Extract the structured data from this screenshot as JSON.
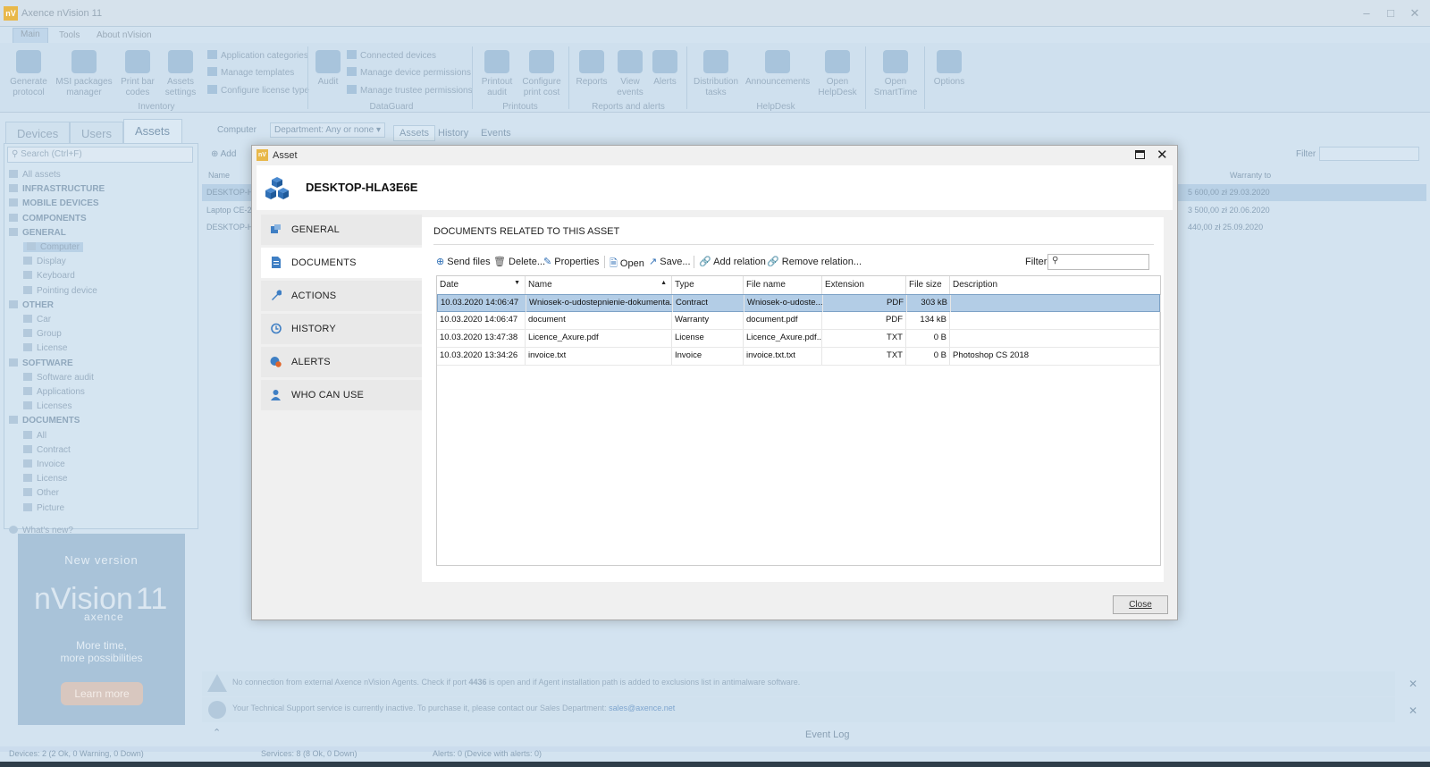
{
  "app": {
    "title": "Axence nVision 11"
  },
  "menu": {
    "tabs": [
      "Main",
      "Tools",
      "About nVision"
    ]
  },
  "ribbon": {
    "inventory": {
      "generate_protocol": "Generate protocol",
      "msi_packages": "MSI packages manager",
      "print_bar_codes": "Print bar codes",
      "assets_settings": "Assets settings",
      "application_categories": "Application categories",
      "manage_templates": "Manage templates",
      "configure_license_type": "Configure license type",
      "group": "Inventory"
    },
    "dataguard": {
      "audit": "Audit",
      "connected_devices": "Connected devices",
      "manage_device_permissions": "Manage device permissions",
      "manage_trustee_permissions": "Manage trustee permissions",
      "group": "DataGuard"
    },
    "printouts": {
      "printout_audit": "Printout audit",
      "configure_print_cost": "Configure print cost",
      "group": "Printouts"
    },
    "reports": {
      "reports": "Reports",
      "view_events": "View events",
      "alerts": "Alerts",
      "group": "Reports and alerts"
    },
    "helpdesk": {
      "distribution_tasks": "Distribution tasks",
      "announcements": "Announcements",
      "open_helpdesk": "Open HelpDesk",
      "group": "HelpDesk"
    },
    "smarttime": {
      "open_smarttime": "Open SmartTime"
    },
    "options": {
      "options": "Options"
    }
  },
  "left": {
    "tabs": [
      "Devices",
      "Users",
      "Assets"
    ],
    "search_placeholder": "Search (Ctrl+F)",
    "tree": [
      {
        "label": "All assets",
        "bold": false,
        "indent": 0
      },
      {
        "label": "INFRASTRUCTURE",
        "bold": true,
        "indent": 0
      },
      {
        "label": "MOBILE DEVICES",
        "bold": true,
        "indent": 0
      },
      {
        "label": "COMPONENTS",
        "bold": true,
        "indent": 0
      },
      {
        "label": "GENERAL",
        "bold": true,
        "indent": 0
      },
      {
        "label": "Computer",
        "bold": false,
        "indent": 1
      },
      {
        "label": "Display",
        "bold": false,
        "indent": 1
      },
      {
        "label": "Keyboard",
        "bold": false,
        "indent": 1
      },
      {
        "label": "Pointing device",
        "bold": false,
        "indent": 1
      },
      {
        "label": "OTHER",
        "bold": true,
        "indent": 0
      },
      {
        "label": "Car",
        "bold": false,
        "indent": 1
      },
      {
        "label": "Group",
        "bold": false,
        "indent": 1
      },
      {
        "label": "License",
        "bold": false,
        "indent": 1
      },
      {
        "label": "SOFTWARE",
        "bold": true,
        "indent": 0
      },
      {
        "label": "Software audit",
        "bold": false,
        "indent": 1
      },
      {
        "label": "Applications",
        "bold": false,
        "indent": 1
      },
      {
        "label": "Licenses",
        "bold": false,
        "indent": 1
      },
      {
        "label": "DOCUMENTS",
        "bold": true,
        "indent": 0
      },
      {
        "label": "All",
        "bold": false,
        "indent": 1
      },
      {
        "label": "Contract",
        "bold": false,
        "indent": 1
      },
      {
        "label": "Invoice",
        "bold": false,
        "indent": 1
      },
      {
        "label": "License",
        "bold": false,
        "indent": 1
      },
      {
        "label": "Other",
        "bold": false,
        "indent": 1
      },
      {
        "label": "Picture",
        "bold": false,
        "indent": 1
      }
    ],
    "whats_new": "What's new?",
    "promo": {
      "heading": "New version",
      "brand": "nVision",
      "version": "11",
      "maker": "axence",
      "tagline1": "More time,",
      "tagline2": "more possibilities",
      "button": "Learn more"
    }
  },
  "main": {
    "toolbar": {
      "computer": "Computer",
      "department": "Department: Any or none",
      "tabs": [
        "Assets",
        "History",
        "Events"
      ],
      "add": "Add",
      "filter": "Filter"
    },
    "columns": {
      "name": "Name",
      "warranty": "Warranty to"
    },
    "rows": [
      {
        "name": "DESKTOP-H",
        "warranty": "5 600,00 zł  29.03.2020"
      },
      {
        "name": "Laptop CE-2",
        "warranty": "3 500,00 zł  20.06.2020"
      },
      {
        "name": "DESKTOP-H",
        "warranty": "440,00 zł  25.09.2020"
      }
    ],
    "notices": [
      {
        "prefix": "No connection from external Axence nVision Agents. Check if port ",
        "port": "4436",
        "suffix": " is open and if Agent installation path is added to exclusions list in antimalware software."
      },
      {
        "text": "Your Technical Support service is currently inactive. To purchase it, please contact our Sales Department: ",
        "email": "sales@axence.net"
      }
    ],
    "event_log": "Event Log"
  },
  "status": {
    "devices": "Devices: 2 (2 Ok, 0 Warning, 0 Down)",
    "services": "Services: 8 (8 Ok, 0 Down)",
    "alerts": "Alerts: 0 (Device with alerts: 0)"
  },
  "dialog": {
    "title": "Asset",
    "asset_name": "DESKTOP-HLA3E6E",
    "nav": [
      "GENERAL",
      "DOCUMENTS",
      "ACTIONS",
      "HISTORY",
      "ALERTS",
      "WHO CAN USE"
    ],
    "selected_nav": "DOCUMENTS",
    "section_title": "DOCUMENTS RELATED TO THIS ASSET",
    "toolbar": {
      "send_files": "Send files",
      "delete": "Delete...",
      "properties": "Properties",
      "open": "Open",
      "save": "Save...",
      "add_relation": "Add relation",
      "remove_relation": "Remove relation...",
      "filter": "Filter"
    },
    "columns": [
      "Date",
      "Name",
      "Type",
      "File name",
      "Extension",
      "File size",
      "Description"
    ],
    "rows": [
      {
        "date": "10.03.2020 14:06:47",
        "name": "Wniosek-o-udostepnienie-dokumenta...",
        "type": "Contract",
        "file": "Wniosek-o-udoste...",
        "ext": "PDF",
        "size": "303 kB",
        "desc": ""
      },
      {
        "date": "10.03.2020 14:06:47",
        "name": "document",
        "type": "Warranty",
        "file": "document.pdf",
        "ext": "PDF",
        "size": "134 kB",
        "desc": ""
      },
      {
        "date": "10.03.2020 13:47:38",
        "name": "Licence_Axure.pdf",
        "type": "License",
        "file": "Licence_Axure.pdf...",
        "ext": "TXT",
        "size": "0 B",
        "desc": ""
      },
      {
        "date": "10.03.2020 13:34:26",
        "name": "invoice.txt",
        "type": "Invoice",
        "file": "invoice.txt.txt",
        "ext": "TXT",
        "size": "0 B",
        "desc": "Photoshop CS 2018"
      }
    ],
    "close": "Close"
  }
}
